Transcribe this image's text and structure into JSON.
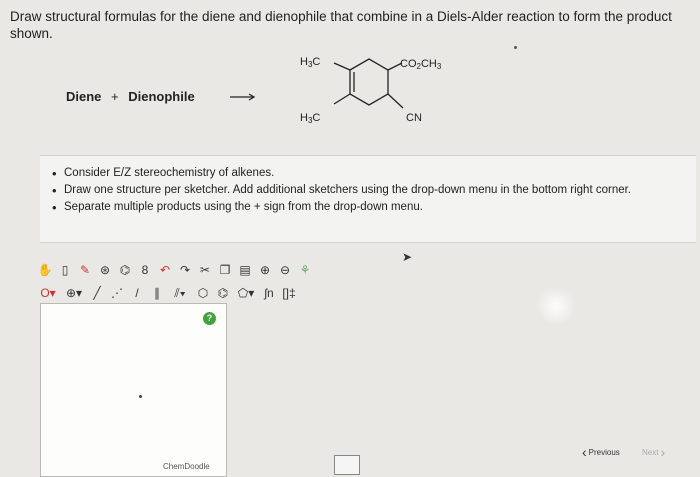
{
  "question": {
    "text": "Draw structural formulas for the diene and dienophile that combine in a Diels-Alder reaction to form the product shown."
  },
  "equation": {
    "diene": "Diene",
    "plus": "+",
    "dienophile": "Dienophile"
  },
  "product": {
    "top_left": "H3C",
    "bottom_left": "H3C",
    "top_right": "CO2CH3",
    "bottom_right": "CN"
  },
  "instructions": [
    "Consider E/Z stereochemistry of alkenes.",
    "Draw one structure per sketcher. Add additional sketchers using the drop-down menu in the bottom right corner.",
    "Separate multiple products using the + sign from the drop-down menu."
  ],
  "sketcher": {
    "brand": "ChemDoodle",
    "help": "?"
  },
  "navigation": {
    "previous": "Previous",
    "next": "Next"
  },
  "colors": {
    "help_badge": "#3fa53b",
    "background": "#e9e8e4"
  }
}
